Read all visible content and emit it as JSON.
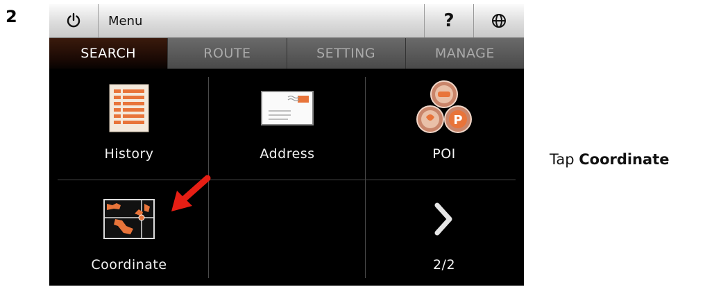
{
  "step": {
    "number": "2"
  },
  "instruction": {
    "prefix": "Tap ",
    "target": "Coordinate"
  },
  "topbar": {
    "title": "Menu",
    "help_label": "?"
  },
  "tabs": [
    {
      "label": "SEARCH",
      "active": true
    },
    {
      "label": "ROUTE",
      "active": false
    },
    {
      "label": "SETTING",
      "active": false
    },
    {
      "label": "MANAGE",
      "active": false
    }
  ],
  "grid": {
    "items": [
      {
        "label": "History",
        "icon": "history-list-icon"
      },
      {
        "label": "Address",
        "icon": "envelope-icon"
      },
      {
        "label": "POI",
        "icon": "poi-icon"
      },
      {
        "label": "Coordinate",
        "icon": "coordinate-map-icon"
      },
      {
        "label": "",
        "icon": ""
      },
      {
        "label": "2/2",
        "icon": "chevron-right-icon"
      }
    ]
  },
  "colors": {
    "accent": "#e8743a",
    "tab_active_bg": "#1a0904",
    "screen_bg": "#000000"
  }
}
